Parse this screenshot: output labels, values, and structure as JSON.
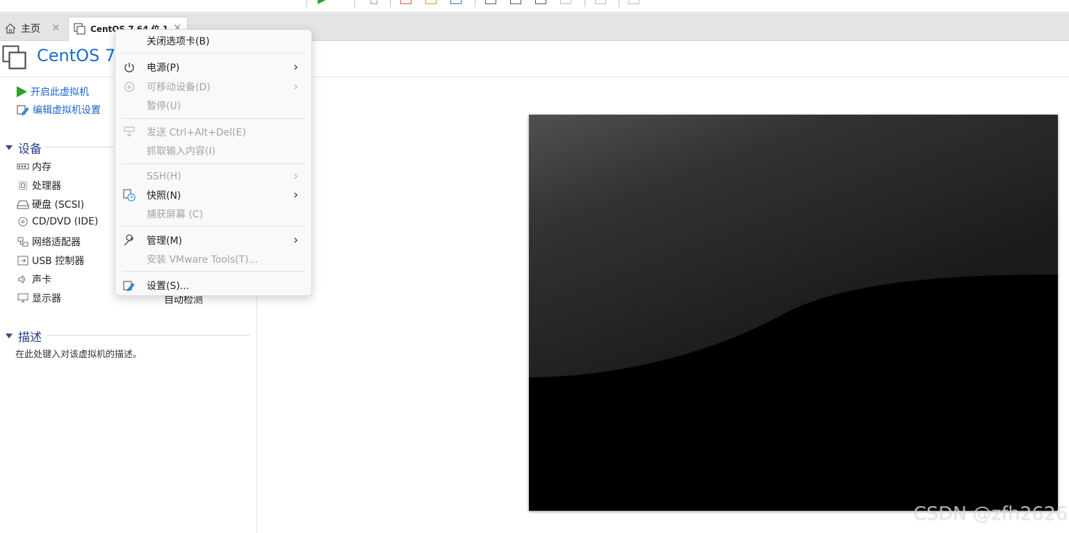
{
  "tabs": {
    "home": {
      "label": "主页"
    },
    "vm": {
      "label": "CentOS 7 64 位 1"
    }
  },
  "vm": {
    "title": "CentOS 7"
  },
  "actions": {
    "power_on": "开启此虚拟机",
    "edit_settings": "编辑虚拟机设置"
  },
  "devices": {
    "section_title": "设备",
    "items": [
      {
        "label": "内存",
        "icon": "memory-icon"
      },
      {
        "label": "处理器",
        "icon": "cpu-icon"
      },
      {
        "label": "硬盘 (SCSI)",
        "icon": "harddisk-icon"
      },
      {
        "label": "CD/DVD (IDE)",
        "icon": "cd-icon"
      },
      {
        "label": "网络适配器",
        "icon": "network-icon"
      },
      {
        "label": "USB 控制器",
        "icon": "usb-icon"
      },
      {
        "label": "声卡",
        "icon": "speaker-icon"
      },
      {
        "label": "显示器",
        "icon": "monitor-icon",
        "value": "自动检测"
      }
    ]
  },
  "description": {
    "section_title": "描述",
    "placeholder": "在此处键入对该虚拟机的描述。"
  },
  "context_menu": {
    "items": [
      {
        "label": "关闭选项卡(B)",
        "enabled": true
      },
      {
        "label": "电源(P)",
        "enabled": true,
        "submenu": true,
        "icon": "power-icon"
      },
      {
        "label": "可移动设备(D)",
        "enabled": false,
        "submenu": true,
        "icon": "removable-device-icon"
      },
      {
        "label": "暂停(U)",
        "enabled": false
      },
      {
        "label": "发送 Ctrl+Alt+Del(E)",
        "enabled": false,
        "icon": "ctrl-alt-del-icon"
      },
      {
        "label": "抓取输入内容(I)",
        "enabled": false
      },
      {
        "label": "SSH(H)",
        "enabled": false,
        "submenu": true
      },
      {
        "label": "快照(N)",
        "enabled": true,
        "submenu": true,
        "icon": "snapshot-icon"
      },
      {
        "label": "捕获屏幕 (C)",
        "enabled": false
      },
      {
        "label": "管理(M)",
        "enabled": true,
        "submenu": true,
        "icon": "wrench-icon"
      },
      {
        "label": "安装 VMware Tools(T)...",
        "enabled": false
      },
      {
        "label": "设置(S)...",
        "enabled": true,
        "icon": "settings-icon"
      }
    ]
  },
  "watermark": "CSDN @zfh2626",
  "colors": {
    "accent": "#1a6ec6",
    "section_title": "#2a3e8c",
    "play_green": "#2ea02e",
    "disabled_text": "#a3a3a3"
  }
}
